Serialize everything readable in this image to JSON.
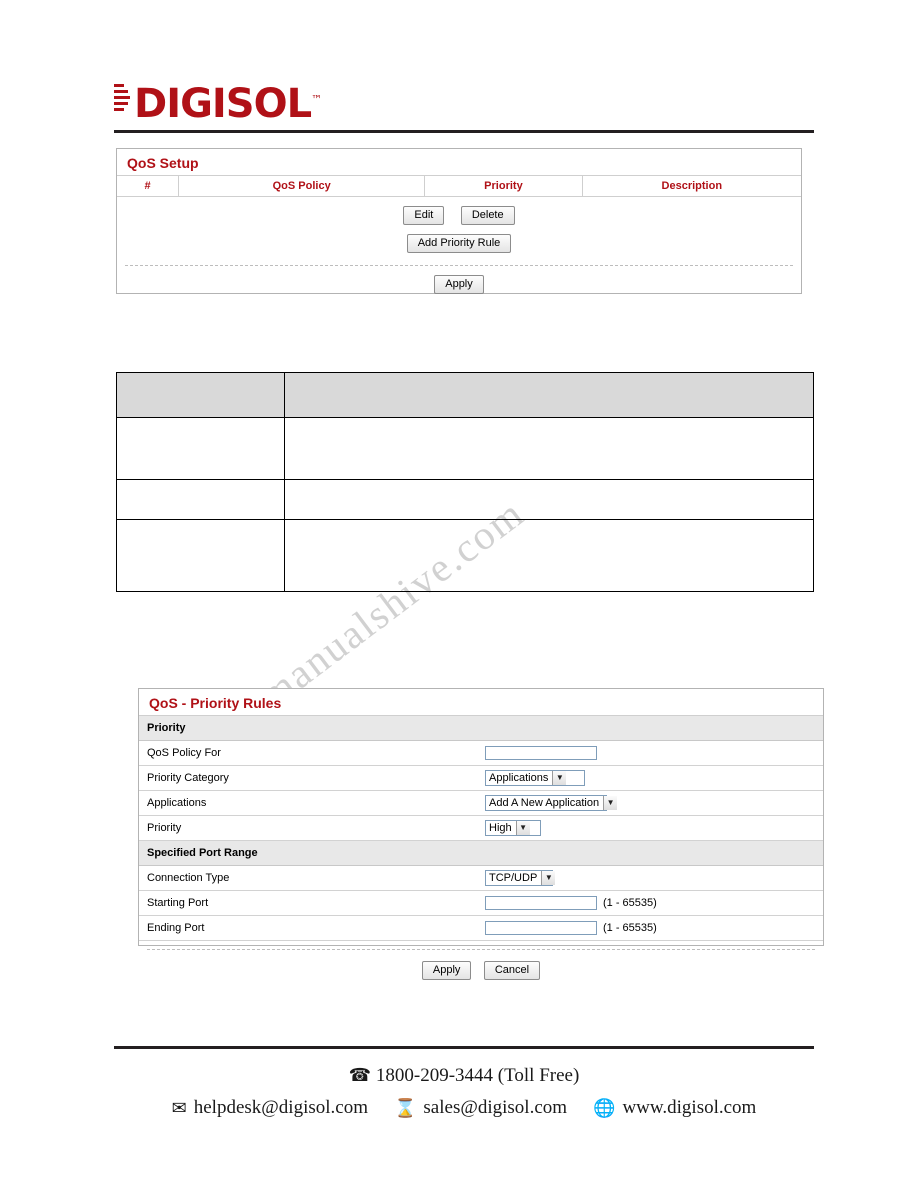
{
  "brand": {
    "name": "DIGISOL",
    "trademark": "™"
  },
  "qos_setup": {
    "title": "QoS Setup",
    "columns": [
      "#",
      "QoS Policy",
      "Priority",
      "Description"
    ],
    "rows": [],
    "buttons": {
      "edit": "Edit",
      "delete": "Delete",
      "add_priority_rule": "Add Priority Rule",
      "apply": "Apply"
    }
  },
  "description_table": {
    "header": [
      "",
      ""
    ],
    "rows": [
      [
        "",
        ""
      ],
      [
        "",
        ""
      ],
      [
        "",
        ""
      ]
    ]
  },
  "qos_rules": {
    "title": "QoS - Priority Rules",
    "sections": {
      "priority": "Priority",
      "port_range": "Specified Port Range"
    },
    "fields": {
      "qos_policy_for": {
        "label": "QoS Policy For",
        "value": ""
      },
      "priority_category": {
        "label": "Priority Category",
        "value": "Applications"
      },
      "applications": {
        "label": "Applications",
        "value": "Add A New Application"
      },
      "priority": {
        "label": "Priority",
        "value": "High"
      },
      "connection_type": {
        "label": "Connection Type",
        "value": "TCP/UDP"
      },
      "starting_port": {
        "label": "Starting Port",
        "value": "",
        "hint": "(1 - 65535)"
      },
      "ending_port": {
        "label": "Ending Port",
        "value": "",
        "hint": "(1 - 65535)"
      }
    },
    "buttons": {
      "apply": "Apply",
      "cancel": "Cancel"
    }
  },
  "watermark": {
    "line1": "manualshive.com",
    "line2": ""
  },
  "footer": {
    "phone_icon": "☎",
    "phone": "1800-209-3444 (Toll Free)",
    "email_icon": "✉",
    "email": "helpdesk@digisol.com",
    "sales_icon": "⌛",
    "sales": "sales@digisol.com",
    "web_icon": "🌐",
    "web": "www.digisol.com"
  },
  "colors": {
    "brand_red": "#b01117",
    "header_gray": "#d9d9d9",
    "section_gray": "#e8e8e8"
  }
}
